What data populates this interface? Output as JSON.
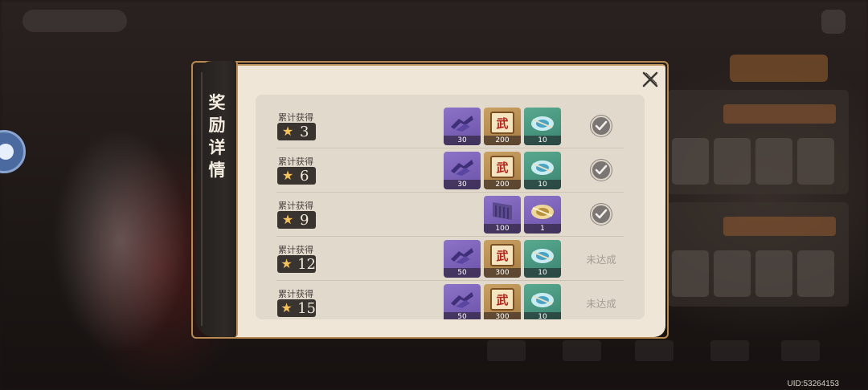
{
  "dialog": {
    "title": "奖励详情",
    "close_icon": "close-x-icon"
  },
  "rows": [
    {
      "label": "累计获得",
      "stars": "3",
      "status": "claimed",
      "rewards": [
        {
          "kind": "purple-material",
          "qty": "30"
        },
        {
          "kind": "martial-scroll",
          "qty": "200"
        },
        {
          "kind": "fan-token",
          "qty": "10"
        }
      ]
    },
    {
      "label": "累计获得",
      "stars": "6",
      "status": "claimed",
      "rewards": [
        {
          "kind": "purple-material",
          "qty": "30"
        },
        {
          "kind": "martial-scroll",
          "qty": "200"
        },
        {
          "kind": "fan-token",
          "qty": "10"
        }
      ]
    },
    {
      "label": "累计获得",
      "stars": "9",
      "status": "claimed",
      "rewards": [
        {
          "kind": "purple-chest",
          "qty": "100"
        },
        {
          "kind": "gold-token",
          "qty": "1"
        }
      ]
    },
    {
      "label": "累计获得",
      "stars": "12",
      "status": "未达成",
      "rewards": [
        {
          "kind": "purple-material",
          "qty": "50"
        },
        {
          "kind": "martial-scroll",
          "qty": "300"
        },
        {
          "kind": "fan-token",
          "qty": "10"
        }
      ]
    },
    {
      "label": "累计获得",
      "stars": "15",
      "status": "未达成",
      "rewards": [
        {
          "kind": "purple-material",
          "qty": "50"
        },
        {
          "kind": "martial-scroll",
          "qty": "300"
        },
        {
          "kind": "fan-token",
          "qty": "10"
        }
      ]
    }
  ],
  "scroll_glyph": "武",
  "footer": {
    "uid": "UID:53264153"
  },
  "colors": {
    "panel_bg": "#efe6d8",
    "list_bg": "#e1d9cc",
    "side_tab": "#2f2a27",
    "accent_border": "#c09058",
    "pending_text": "#a39c92"
  }
}
